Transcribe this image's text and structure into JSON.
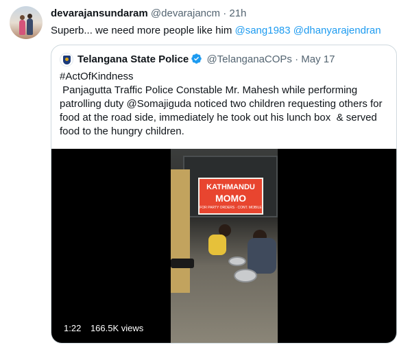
{
  "tweet": {
    "display_name": "devarajansundaram",
    "handle": "@devarajancm",
    "separator": "·",
    "time": "21h",
    "text": "Superb... we need more people like him ",
    "mentions": [
      "@sang1983",
      "@dhanyarajendran"
    ]
  },
  "quoted": {
    "display_name": "Telangana State Police",
    "verified": true,
    "handle": "@TelanganaCOPs",
    "separator": "·",
    "date": "May 17",
    "hashtag": "#ActOfKindness",
    "body": " Panjagutta Traffic Police Constable Mr. Mahesh while performing patrolling duty @Somajiguda noticed two children requesting others for food at the road side, immediately he took out his lunch box  & served food to the hungry children.",
    "video": {
      "sign_line1": "KATHMANDU",
      "sign_line2": "MOMO",
      "sign_line3": "FOR PARTY ORDERS · CONT. MOBILE",
      "duration": "1:22",
      "views": "166.5K views"
    }
  },
  "colors": {
    "link": "#1d9bf0",
    "muted": "#536471",
    "border": "#cfd9de",
    "verified": "#1d9bf0"
  },
  "icons": [
    "verified-badge-icon"
  ]
}
